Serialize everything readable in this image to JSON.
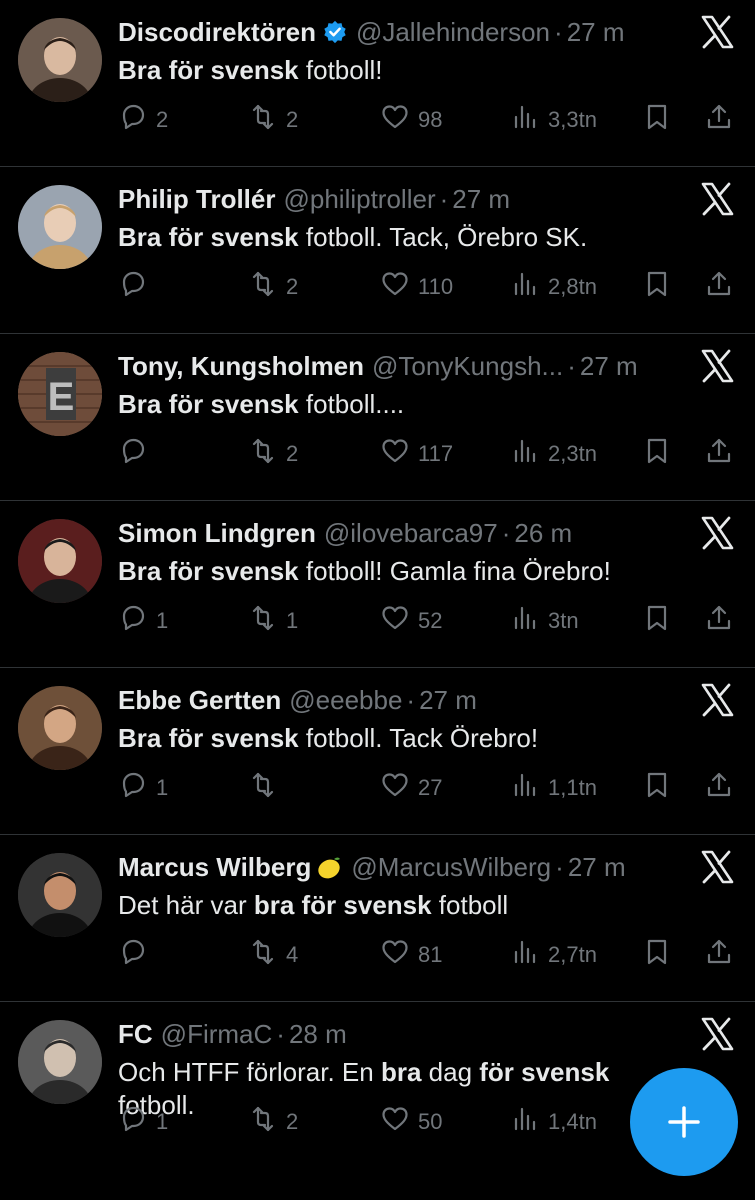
{
  "accent_color": "#1d9bf0",
  "tweets": [
    {
      "name": "Discodirektören",
      "verified": true,
      "handle": "@Jallehinderson",
      "time": "27 m",
      "body_html": "<b>Bra för svensk</b> fotboll!",
      "replies": "2",
      "retweets": "2",
      "likes": "98",
      "views": "3,3tn"
    },
    {
      "name": "Philip Trollér",
      "handle": "@philiptroller",
      "time": "27 m",
      "body_html": "<b>Bra för svensk</b> fotboll. Tack, Örebro SK.",
      "replies": "",
      "retweets": "2",
      "likes": "110",
      "views": "2,8tn"
    },
    {
      "name": "Tony, Kungsholmen",
      "handle": "@TonyKungsh...",
      "time": "27 m",
      "body_html": "<b>Bra för svensk</b> fotboll....",
      "replies": "",
      "retweets": "2",
      "likes": "117",
      "views": "2,3tn"
    },
    {
      "name": "Simon Lindgren",
      "handle": "@ilovebarca97",
      "time": "26 m",
      "body_html": "<b>Bra för svensk</b> fotboll! Gamla fina Örebro!",
      "replies": "1",
      "retweets": "1",
      "likes": "52",
      "views": "3tn"
    },
    {
      "name": "Ebbe Gertten",
      "handle": "@eeebbe",
      "time": "27 m",
      "body_html": "<b>Bra för svensk</b> fotboll. Tack Örebro!",
      "replies": "1",
      "retweets": "",
      "likes": "27",
      "views": "1,1tn"
    },
    {
      "name": "Marcus Wilberg",
      "lemon": true,
      "handle": "@MarcusWilberg",
      "time": "27 m",
      "body_html": "Det här var <b>bra för svensk</b> fotboll",
      "replies": "",
      "retweets": "4",
      "likes": "81",
      "views": "2,7tn"
    },
    {
      "name": "FC",
      "handle": "@FirmaC",
      "time": "28 m",
      "body_html": "Och HTFF förlorar. En <b>bra</b> dag <b>för svensk</b><br>fotboll.",
      "replies": "1",
      "retweets": "2",
      "likes": "50",
      "views": "1,4tn"
    }
  ],
  "icons": {
    "verified": "verified-badge-icon",
    "x_logo": "x-logo-icon",
    "reply": "reply-icon",
    "retweet": "retweet-icon",
    "like": "heart-icon",
    "views": "views-icon",
    "bookmark": "bookmark-icon",
    "share": "share-icon",
    "compose": "plus-icon"
  }
}
